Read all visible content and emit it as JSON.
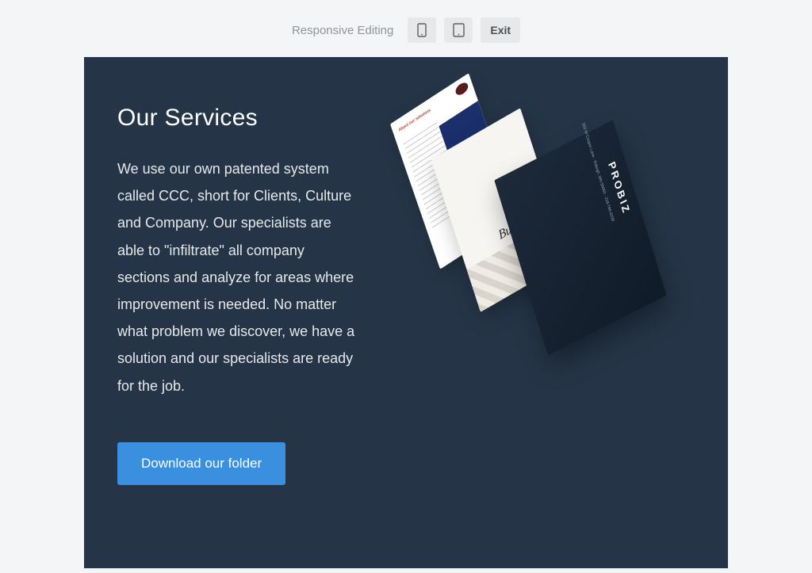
{
  "toolbar": {
    "label": "Responsive Editing",
    "exit_label": "Exit"
  },
  "section": {
    "heading": "Our Services",
    "body": "We use our own patented system called CCC, short for Clients, Culture and Company. Our specialists are able to \"infiltrate\" all company sections and analyze for areas where improvement is needed. No matter what problem we discover, we have a solution and our specialists are ready for the job.",
    "cta_label": "Download our folder"
  },
  "brochure": {
    "brand": "PROBIZ",
    "mid_title": "Bus",
    "left_headline": "About our solutions",
    "cover_lines": "363 W Cooper Lane · Raleigh, MN 56063 · 218-766-5239"
  }
}
